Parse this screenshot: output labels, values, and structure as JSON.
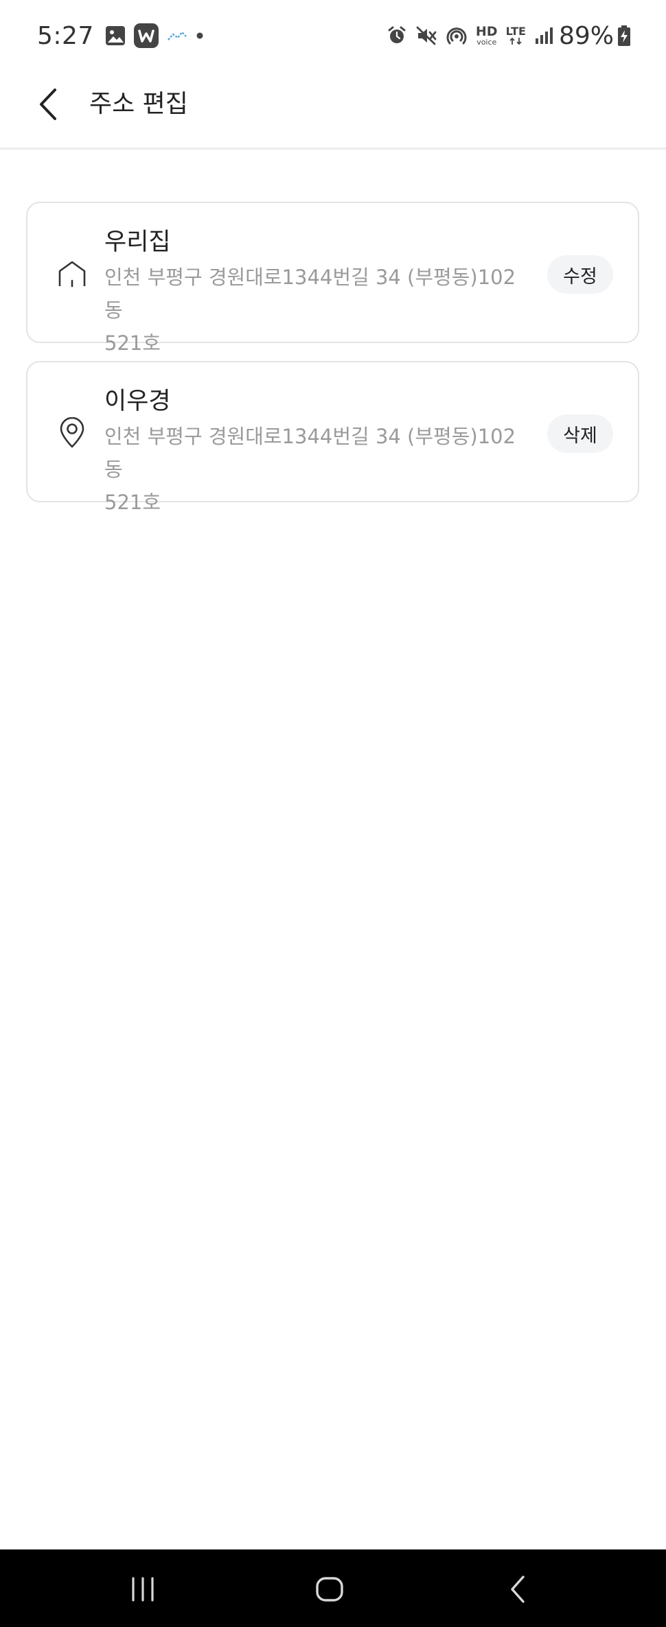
{
  "status_bar": {
    "time": "5:27",
    "hd_label_top": "HD",
    "hd_label_bottom": "voice",
    "lte_label": "LTE",
    "battery_percent": "89%"
  },
  "header": {
    "title": "주소 편집"
  },
  "addresses": [
    {
      "name": "우리집",
      "address_line1": "인천 부평구 경원대로1344번길 34 (부평동)102동",
      "address_line2": "521호",
      "icon": "home-icon",
      "action_label": "수정"
    },
    {
      "name": "이우경",
      "address_line1": "인천 부평구 경원대로1344번길 34 (부평동)102동",
      "address_line2": "521호",
      "icon": "location-pin-icon",
      "action_label": "삭제"
    }
  ],
  "colors": {
    "text_primary": "#222222",
    "text_secondary": "#9a9a9a",
    "card_border": "#e3e3e3",
    "button_bg": "#f3f4f6",
    "nav_bg": "#000000"
  }
}
